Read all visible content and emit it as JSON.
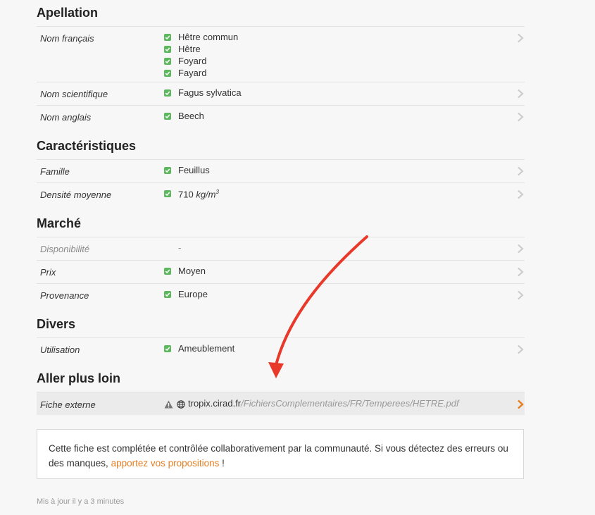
{
  "sections": {
    "apellation": {
      "title": "Apellation",
      "rows": [
        {
          "label": "Nom français",
          "values": [
            "Hêtre commun",
            "Hêtre",
            "Foyard",
            "Fayard"
          ]
        },
        {
          "label": "Nom scientifique",
          "values": [
            "Fagus sylvatica"
          ]
        },
        {
          "label": "Nom anglais",
          "values": [
            "Beech"
          ]
        }
      ]
    },
    "caracteristiques": {
      "title": "Caractéristiques",
      "rows": [
        {
          "label": "Famille",
          "values": [
            "Feuillus"
          ]
        },
        {
          "label": "Densité moyenne",
          "value_prefix": "710 ",
          "value_unit": "kg/m",
          "value_sup": "3"
        }
      ]
    },
    "marche": {
      "title": "Marché",
      "rows": [
        {
          "label": "Disponibilité",
          "empty_value": "-"
        },
        {
          "label": "Prix",
          "values": [
            "Moyen"
          ]
        },
        {
          "label": "Provenance",
          "values": [
            "Europe"
          ]
        }
      ]
    },
    "divers": {
      "title": "Divers",
      "rows": [
        {
          "label": "Utilisation",
          "values": [
            "Ameublement"
          ]
        }
      ]
    },
    "aller": {
      "title": "Aller plus loin",
      "rows": [
        {
          "label": "Fiche externe",
          "link_domain": "tropix.cirad.fr",
          "link_path": "/FichiersComplementaires/FR/Temperees/HETRE.pdf"
        }
      ]
    }
  },
  "note": {
    "text_before": "Cette fiche est complétée et contrôlée collaborativement par la communauté. Si vous détectez des erreurs ou des manques, ",
    "link_text": "apportez vos propositions",
    "text_after": " !"
  },
  "updated": "Mis à jour il y a 3 minutes",
  "colors": {
    "check": "#5cb85c",
    "chevron": "#cccccc",
    "chevron_active": "#e67e22",
    "arrow": "#e8392a",
    "link": "#e67e22"
  }
}
